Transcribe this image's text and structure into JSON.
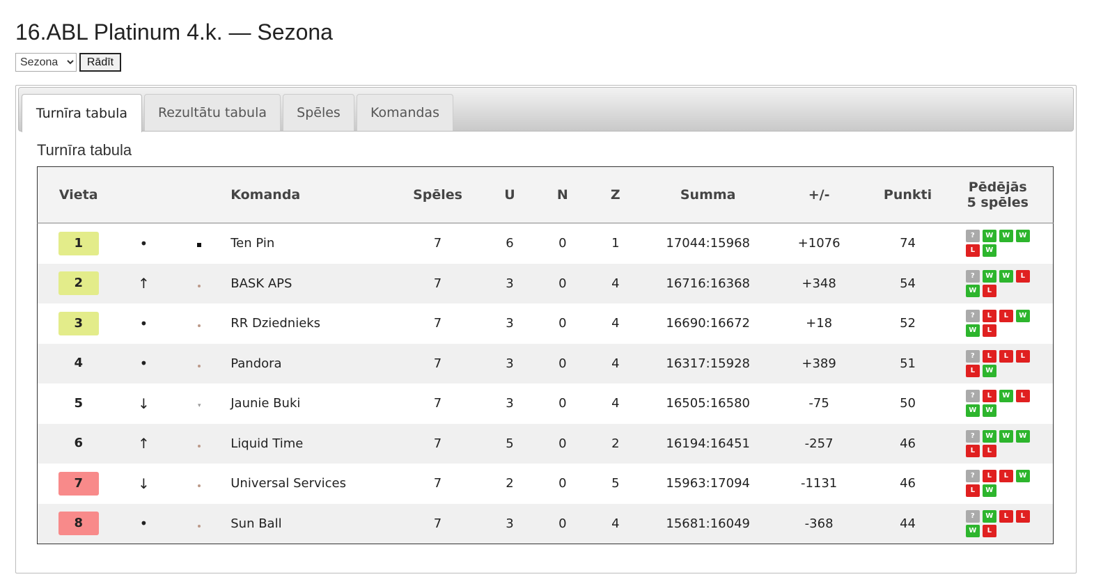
{
  "page": {
    "title": "16.ABL Platinum 4.k. — Sezona"
  },
  "controls": {
    "season_selected": "Sezona",
    "season_options": [
      "Sezona"
    ],
    "show_label": "Rādīt"
  },
  "tabs": [
    {
      "label": "Turnīra tabula",
      "active": true
    },
    {
      "label": "Rezultātu tabula",
      "active": false
    },
    {
      "label": "Spēles",
      "active": false
    },
    {
      "label": "Komandas",
      "active": false
    }
  ],
  "section": {
    "title": "Turnīra tabula"
  },
  "table": {
    "headers": {
      "place": "Vieta",
      "team": "Komanda",
      "games": "Spēles",
      "wins": "U",
      "draws": "N",
      "losses": "Z",
      "sum": "Summa",
      "diff": "+/-",
      "points": "Punkti",
      "last5_line1": "Pēdējās",
      "last5_line2": "5 spēles"
    },
    "rows": [
      {
        "place": "1",
        "zone": "top",
        "trend": "•",
        "marker": "square",
        "team": "Ten Pin",
        "games": "7",
        "wins": "6",
        "draws": "0",
        "losses": "1",
        "sum": "17044:15968",
        "diff": "+1076",
        "points": "74",
        "form": [
          "?",
          "W",
          "W",
          "W",
          "L",
          "W"
        ]
      },
      {
        "place": "2",
        "zone": "top",
        "trend": "↑",
        "marker": "small",
        "team": "BASK APS",
        "games": "7",
        "wins": "3",
        "draws": "0",
        "losses": "4",
        "sum": "16716:16368",
        "diff": "+348",
        "points": "54",
        "form": [
          "?",
          "W",
          "W",
          "L",
          "W",
          "L"
        ]
      },
      {
        "place": "3",
        "zone": "top",
        "trend": "•",
        "marker": "small",
        "team": "RR Dziednieks",
        "games": "7",
        "wins": "3",
        "draws": "0",
        "losses": "4",
        "sum": "16690:16672",
        "diff": "+18",
        "points": "52",
        "form": [
          "?",
          "L",
          "L",
          "W",
          "W",
          "L"
        ]
      },
      {
        "place": "4",
        "zone": "mid",
        "trend": "•",
        "marker": "small",
        "team": "Pandora",
        "games": "7",
        "wins": "3",
        "draws": "0",
        "losses": "4",
        "sum": "16317:15928",
        "diff": "+389",
        "points": "51",
        "form": [
          "?",
          "L",
          "L",
          "L",
          "L",
          "W"
        ]
      },
      {
        "place": "5",
        "zone": "mid",
        "trend": "↓",
        "marker": "small-v",
        "team": "Jaunie Buki",
        "games": "7",
        "wins": "3",
        "draws": "0",
        "losses": "4",
        "sum": "16505:16580",
        "diff": "-75",
        "points": "50",
        "form": [
          "?",
          "L",
          "W",
          "L",
          "W",
          "W"
        ]
      },
      {
        "place": "6",
        "zone": "mid",
        "trend": "↑",
        "marker": "small",
        "team": "Liquid Time",
        "games": "7",
        "wins": "5",
        "draws": "0",
        "losses": "2",
        "sum": "16194:16451",
        "diff": "-257",
        "points": "46",
        "form": [
          "?",
          "W",
          "W",
          "W",
          "L",
          "L"
        ]
      },
      {
        "place": "7",
        "zone": "bottom",
        "trend": "↓",
        "marker": "small",
        "team": "Universal Services",
        "games": "7",
        "wins": "2",
        "draws": "0",
        "losses": "5",
        "sum": "15963:17094",
        "diff": "-1131",
        "points": "46",
        "form": [
          "?",
          "L",
          "L",
          "W",
          "L",
          "W"
        ]
      },
      {
        "place": "8",
        "zone": "bottom",
        "trend": "•",
        "marker": "small",
        "team": "Sun Ball",
        "games": "7",
        "wins": "3",
        "draws": "0",
        "losses": "4",
        "sum": "15681:16049",
        "diff": "-368",
        "points": "44",
        "form": [
          "?",
          "W",
          "L",
          "L",
          "W",
          "L"
        ]
      }
    ]
  }
}
